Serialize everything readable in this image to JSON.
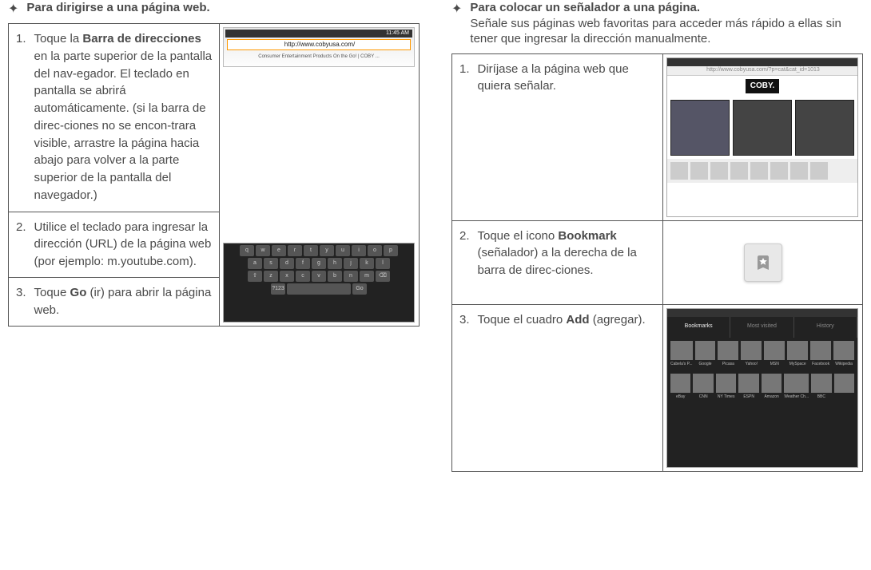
{
  "left": {
    "title": "Para dirigirse a una página web.",
    "steps": [
      {
        "num": "1.",
        "text_before_bold": "Toque la ",
        "bold": "Barra de direcciones",
        "text_after_bold": " en la parte superior de la pantalla del nav-egador. El teclado en pantalla se abrirá automáticamente. (si la barra de direc-ciones no se encon-trara visible, arrastre la página hacia abajo para volver a la parte superior de la pantalla del navegador.)"
      },
      {
        "num": "2.",
        "text": "Utilice el teclado para ingresar la dirección (URL) de la página web (por ejemplo: m.youtube.com)."
      },
      {
        "num": "3.",
        "text_before_bold": "Toque ",
        "bold": "Go",
        "text_after_bold": " (ir) para abrir la página web."
      }
    ],
    "img_addressbar": {
      "time": "11:45 AM",
      "url": "http://www.cobyusa.com/",
      "result": "Consumer Entertainment Products On the Go! | COBY ..."
    }
  },
  "right": {
    "title": "Para colocar un señalador a una página.",
    "subtitle": "Señale sus páginas web favoritas para acceder más rápido a ellas sin tener que ingresar la dirección manualmente.",
    "steps": [
      {
        "num": "1.",
        "text": "Diríjase a la página web que quiera señalar."
      },
      {
        "num": "2.",
        "text_before_bold": "Toque el icono ",
        "bold": "Bookmark",
        "text_after_bold": " (señalador) a la derecha de la barra de direc-ciones."
      },
      {
        "num": "3.",
        "text_before_bold": "Toque el cuadro ",
        "bold": "Add",
        "text_after_bold": " (agregar)."
      }
    ],
    "img_coby": {
      "addr": "http://www.cobyusa.com/?p=cat&cat_id=1013",
      "brand": "COBY."
    },
    "img_grid": {
      "tabs": [
        "Bookmarks",
        "Most visited",
        "History"
      ],
      "row1": [
        "Cabela's P...",
        "Google",
        "Picasa",
        "Yahoo!",
        "MSN",
        "MySpace",
        "Facebook",
        "Wikipedia"
      ],
      "row2": [
        "eBay",
        "CNN",
        "NY Times",
        "ESPN",
        "Amazon",
        "Weather Ch...",
        "BBC",
        ""
      ]
    }
  }
}
